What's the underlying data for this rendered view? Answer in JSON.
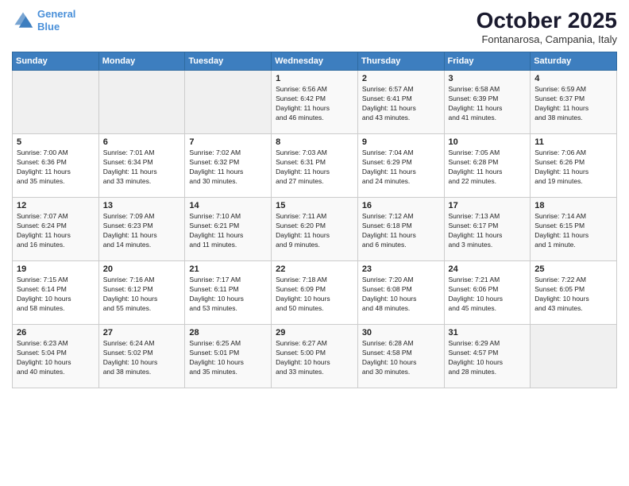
{
  "header": {
    "logo_line1": "General",
    "logo_line2": "Blue",
    "month_title": "October 2025",
    "location": "Fontanarosa, Campania, Italy"
  },
  "weekdays": [
    "Sunday",
    "Monday",
    "Tuesday",
    "Wednesday",
    "Thursday",
    "Friday",
    "Saturday"
  ],
  "weeks": [
    [
      {
        "day": "",
        "info": ""
      },
      {
        "day": "",
        "info": ""
      },
      {
        "day": "",
        "info": ""
      },
      {
        "day": "1",
        "info": "Sunrise: 6:56 AM\nSunset: 6:42 PM\nDaylight: 11 hours\nand 46 minutes."
      },
      {
        "day": "2",
        "info": "Sunrise: 6:57 AM\nSunset: 6:41 PM\nDaylight: 11 hours\nand 43 minutes."
      },
      {
        "day": "3",
        "info": "Sunrise: 6:58 AM\nSunset: 6:39 PM\nDaylight: 11 hours\nand 41 minutes."
      },
      {
        "day": "4",
        "info": "Sunrise: 6:59 AM\nSunset: 6:37 PM\nDaylight: 11 hours\nand 38 minutes."
      }
    ],
    [
      {
        "day": "5",
        "info": "Sunrise: 7:00 AM\nSunset: 6:36 PM\nDaylight: 11 hours\nand 35 minutes."
      },
      {
        "day": "6",
        "info": "Sunrise: 7:01 AM\nSunset: 6:34 PM\nDaylight: 11 hours\nand 33 minutes."
      },
      {
        "day": "7",
        "info": "Sunrise: 7:02 AM\nSunset: 6:32 PM\nDaylight: 11 hours\nand 30 minutes."
      },
      {
        "day": "8",
        "info": "Sunrise: 7:03 AM\nSunset: 6:31 PM\nDaylight: 11 hours\nand 27 minutes."
      },
      {
        "day": "9",
        "info": "Sunrise: 7:04 AM\nSunset: 6:29 PM\nDaylight: 11 hours\nand 24 minutes."
      },
      {
        "day": "10",
        "info": "Sunrise: 7:05 AM\nSunset: 6:28 PM\nDaylight: 11 hours\nand 22 minutes."
      },
      {
        "day": "11",
        "info": "Sunrise: 7:06 AM\nSunset: 6:26 PM\nDaylight: 11 hours\nand 19 minutes."
      }
    ],
    [
      {
        "day": "12",
        "info": "Sunrise: 7:07 AM\nSunset: 6:24 PM\nDaylight: 11 hours\nand 16 minutes."
      },
      {
        "day": "13",
        "info": "Sunrise: 7:09 AM\nSunset: 6:23 PM\nDaylight: 11 hours\nand 14 minutes."
      },
      {
        "day": "14",
        "info": "Sunrise: 7:10 AM\nSunset: 6:21 PM\nDaylight: 11 hours\nand 11 minutes."
      },
      {
        "day": "15",
        "info": "Sunrise: 7:11 AM\nSunset: 6:20 PM\nDaylight: 11 hours\nand 9 minutes."
      },
      {
        "day": "16",
        "info": "Sunrise: 7:12 AM\nSunset: 6:18 PM\nDaylight: 11 hours\nand 6 minutes."
      },
      {
        "day": "17",
        "info": "Sunrise: 7:13 AM\nSunset: 6:17 PM\nDaylight: 11 hours\nand 3 minutes."
      },
      {
        "day": "18",
        "info": "Sunrise: 7:14 AM\nSunset: 6:15 PM\nDaylight: 11 hours\nand 1 minute."
      }
    ],
    [
      {
        "day": "19",
        "info": "Sunrise: 7:15 AM\nSunset: 6:14 PM\nDaylight: 10 hours\nand 58 minutes."
      },
      {
        "day": "20",
        "info": "Sunrise: 7:16 AM\nSunset: 6:12 PM\nDaylight: 10 hours\nand 55 minutes."
      },
      {
        "day": "21",
        "info": "Sunrise: 7:17 AM\nSunset: 6:11 PM\nDaylight: 10 hours\nand 53 minutes."
      },
      {
        "day": "22",
        "info": "Sunrise: 7:18 AM\nSunset: 6:09 PM\nDaylight: 10 hours\nand 50 minutes."
      },
      {
        "day": "23",
        "info": "Sunrise: 7:20 AM\nSunset: 6:08 PM\nDaylight: 10 hours\nand 48 minutes."
      },
      {
        "day": "24",
        "info": "Sunrise: 7:21 AM\nSunset: 6:06 PM\nDaylight: 10 hours\nand 45 minutes."
      },
      {
        "day": "25",
        "info": "Sunrise: 7:22 AM\nSunset: 6:05 PM\nDaylight: 10 hours\nand 43 minutes."
      }
    ],
    [
      {
        "day": "26",
        "info": "Sunrise: 6:23 AM\nSunset: 5:04 PM\nDaylight: 10 hours\nand 40 minutes."
      },
      {
        "day": "27",
        "info": "Sunrise: 6:24 AM\nSunset: 5:02 PM\nDaylight: 10 hours\nand 38 minutes."
      },
      {
        "day": "28",
        "info": "Sunrise: 6:25 AM\nSunset: 5:01 PM\nDaylight: 10 hours\nand 35 minutes."
      },
      {
        "day": "29",
        "info": "Sunrise: 6:27 AM\nSunset: 5:00 PM\nDaylight: 10 hours\nand 33 minutes."
      },
      {
        "day": "30",
        "info": "Sunrise: 6:28 AM\nSunset: 4:58 PM\nDaylight: 10 hours\nand 30 minutes."
      },
      {
        "day": "31",
        "info": "Sunrise: 6:29 AM\nSunset: 4:57 PM\nDaylight: 10 hours\nand 28 minutes."
      },
      {
        "day": "",
        "info": ""
      }
    ]
  ]
}
